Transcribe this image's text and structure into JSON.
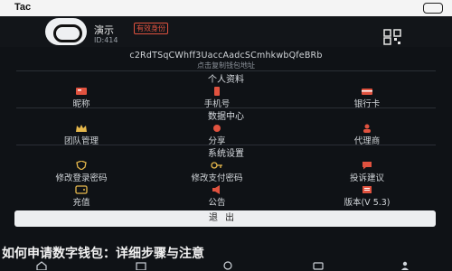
{
  "status_bar": {
    "app_name": "Tac"
  },
  "profile": {
    "nickname": "演示",
    "badge": "有效身份",
    "uid": "ID:414"
  },
  "wallet": {
    "address": "c2RdTSqCWhff3UaccAadcSCmhkwbQfeBRb",
    "hint": "点击复制钱包地址"
  },
  "sections": {
    "personal": {
      "title": "个人资料",
      "items": [
        {
          "label": "昵称",
          "icon": "id-card-icon",
          "color": "#e0523f"
        },
        {
          "label": "手机号",
          "icon": "phone-icon",
          "color": "#e0523f"
        },
        {
          "label": "银行卡",
          "icon": "card-icon",
          "color": "#e0523f"
        }
      ]
    },
    "data_center": {
      "title": "数据中心",
      "items": [
        {
          "label": "团队管理",
          "icon": "crown-icon",
          "color": "#e6b84c"
        },
        {
          "label": "分享",
          "icon": "share-icon",
          "color": "#e0523f"
        },
        {
          "label": "代理商",
          "icon": "agent-icon",
          "color": "#e0523f"
        }
      ]
    },
    "system": {
      "title": "系统设置",
      "items": [
        {
          "label": "修改登录密码",
          "icon": "shield-icon",
          "color": "#e6b84c"
        },
        {
          "label": "修改支付密码",
          "icon": "key-icon",
          "color": "#e6b84c"
        },
        {
          "label": "投诉建议",
          "icon": "feedback-icon",
          "color": "#e0523f"
        },
        {
          "label": "充值",
          "icon": "wallet-icon",
          "color": "#e6b84c"
        },
        {
          "label": "公告",
          "icon": "announce-icon",
          "color": "#e0523f"
        },
        {
          "label": "版本(V 5.3)",
          "icon": "version-icon",
          "color": "#e0523f"
        }
      ]
    }
  },
  "logout_label": "退出",
  "footer_title": "如何申请数字钱包：详细步骤与注意",
  "accent_red": "#e0523f",
  "accent_gold": "#e6b84c"
}
